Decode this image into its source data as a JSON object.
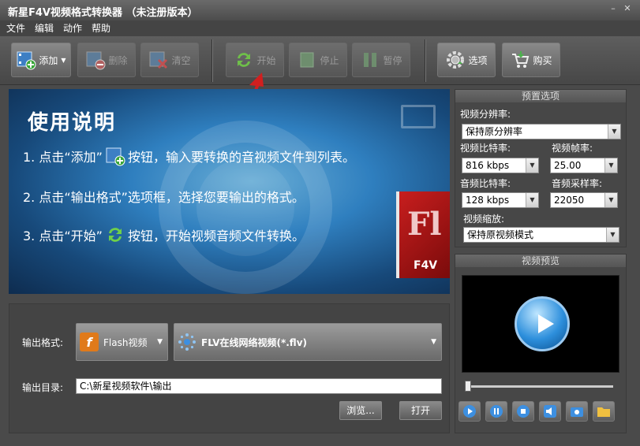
{
  "app": {
    "title": "新星F4V视频格式转换器 （未注册版本）"
  },
  "window_controls": {
    "minimize": "–",
    "close": "✕"
  },
  "menu": [
    "文件",
    "编辑",
    "动作",
    "帮助"
  ],
  "toolbar": {
    "add": "添加",
    "delete": "删除",
    "clear": "清空",
    "start": "开始",
    "stop": "停止",
    "pause": "暂停",
    "options": "选项",
    "buy": "购买"
  },
  "banner": {
    "title": "使用说明",
    "step1_a": "1. 点击“添加”",
    "step1_b": "按钮，输入要转换的音视频文件到列表。",
    "step2": "2. 点击“输出格式”选项框，选择您要输出的格式。",
    "step3_a": "3. 点击“开始”",
    "step3_b": "按钮，开始视频音频文件转换。",
    "logo_fl": "Fl",
    "logo_f4v": "F4V"
  },
  "output": {
    "format_label": "输出格式:",
    "format_category": "Flash视频",
    "format_value": "FLV在线网络视频(*.flv)",
    "dir_label": "输出目录:",
    "dir_value": "C:\\新星视频软件\\输出",
    "browse": "浏览...",
    "open": "打开"
  },
  "presets": {
    "header": "预置选项",
    "resolution_label": "视频分辨率:",
    "resolution_value": "保持原分辨率",
    "vbitrate_label": "视频比特率:",
    "vbitrate_value": "816 kbps",
    "framerate_label": "视频帧率:",
    "framerate_value": "25.00",
    "abitrate_label": "音频比特率:",
    "abitrate_value": "128 kbps",
    "samplerate_label": "音频采样率:",
    "samplerate_value": "22050",
    "scale_label": "视频缩放:",
    "scale_value": "保持原视频模式"
  },
  "preview": {
    "header": "视频预览",
    "slider_position": 0.0
  },
  "colors": {
    "background": "#4a4a4a",
    "accent_blue": "#2d8fdc",
    "arrow_red": "#d11f1f"
  }
}
